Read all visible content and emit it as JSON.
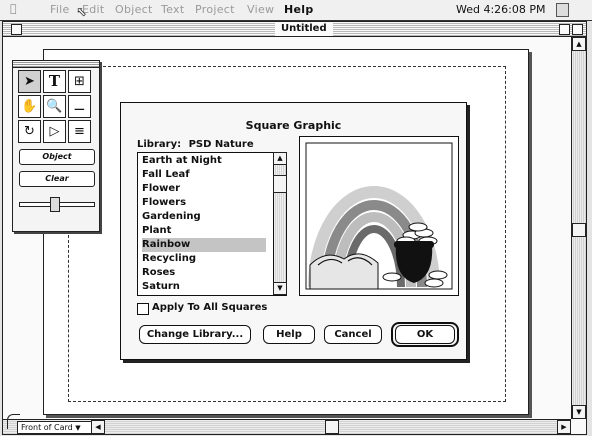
{
  "menubar": {
    "items": [
      "File",
      "Edit",
      "Object",
      "Text",
      "Project",
      "View",
      "Help"
    ],
    "active": "Help",
    "clock": "Wed 4:26:08 PM"
  },
  "window": {
    "title": "Untitled"
  },
  "palette": {
    "tools": [
      "arrow-tool",
      "text-tool",
      "frame-tool",
      "hand-tool",
      "zoom-tool",
      "trash-tool",
      "rotate-tool",
      "flip-tool",
      "stack-tool"
    ],
    "text_tool_label": "T",
    "object_label": "Object",
    "clear_label": "Clear"
  },
  "dialog": {
    "title": "Square Graphic",
    "library_label": "Library:",
    "library_name": "PSD Nature",
    "items": [
      "Earth at Night",
      "Fall Leaf",
      "Flower",
      "Flowers",
      "Gardening",
      "Plant",
      "Rainbow",
      "Recycling",
      "Roses",
      "Saturn"
    ],
    "selected": "Rainbow",
    "apply_label": "Apply To All Squares",
    "apply_checked": false,
    "buttons": {
      "change_library": "Change Library...",
      "help": "Help",
      "cancel": "Cancel",
      "ok": "OK"
    }
  },
  "footer": {
    "card_selector": "Front of Card"
  }
}
